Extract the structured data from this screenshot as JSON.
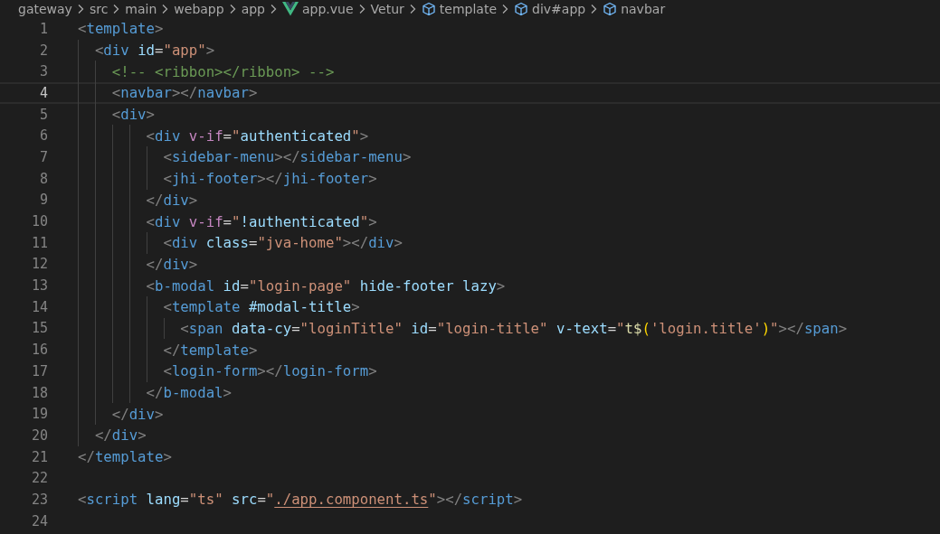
{
  "breadcrumbs": [
    {
      "text": "gateway",
      "kind": "folder"
    },
    {
      "text": "src",
      "kind": "folder"
    },
    {
      "text": "main",
      "kind": "folder"
    },
    {
      "text": "webapp",
      "kind": "folder"
    },
    {
      "text": "app",
      "kind": "folder"
    },
    {
      "text": "app.vue",
      "kind": "vue-file"
    },
    {
      "text": "Vetur",
      "kind": "folder"
    },
    {
      "text": "template",
      "kind": "symbol"
    },
    {
      "text": "div#app",
      "kind": "symbol"
    },
    {
      "text": "navbar",
      "kind": "symbol"
    }
  ],
  "editor": {
    "lines": [
      {
        "number": "1",
        "selected": false,
        "tokens": [
          {
            "kind": "punct",
            "text": "<"
          },
          {
            "kind": "tag",
            "text": "template"
          },
          {
            "kind": "punct",
            "text": ">"
          }
        ]
      },
      {
        "number": "2",
        "selected": false,
        "tokens": [
          {
            "kind": "punct",
            "text": "  <"
          },
          {
            "kind": "tag",
            "text": "div"
          },
          {
            "kind": "attr",
            "text": " id"
          },
          {
            "kind": "eq",
            "text": "="
          },
          {
            "kind": "string",
            "text": "\"app\""
          },
          {
            "kind": "punct",
            "text": ">"
          }
        ]
      },
      {
        "number": "3",
        "selected": false,
        "tokens": [
          {
            "kind": "comment",
            "text": "    <!-- <ribbon></ribbon> -->"
          }
        ]
      },
      {
        "number": "4",
        "selected": true,
        "tokens": [
          {
            "kind": "punct",
            "text": "    <"
          },
          {
            "kind": "tag",
            "text": "navbar"
          },
          {
            "kind": "punct",
            "text": "></"
          },
          {
            "kind": "tag",
            "text": "navbar"
          },
          {
            "kind": "punct",
            "text": ">"
          }
        ]
      },
      {
        "number": "5",
        "selected": false,
        "tokens": [
          {
            "kind": "punct",
            "text": "    <"
          },
          {
            "kind": "tag",
            "text": "div"
          },
          {
            "kind": "punct",
            "text": ">"
          }
        ]
      },
      {
        "number": "6",
        "selected": false,
        "tokens": [
          {
            "kind": "punct",
            "text": "        <"
          },
          {
            "kind": "tag",
            "text": "div"
          },
          {
            "kind": "directive",
            "text": " v-if"
          },
          {
            "kind": "eq",
            "text": "="
          },
          {
            "kind": "string",
            "text": "\""
          },
          {
            "kind": "expr",
            "text": "authenticated"
          },
          {
            "kind": "string",
            "text": "\""
          },
          {
            "kind": "punct",
            "text": ">"
          }
        ]
      },
      {
        "number": "7",
        "selected": false,
        "tokens": [
          {
            "kind": "punct",
            "text": "          <"
          },
          {
            "kind": "tag",
            "text": "sidebar-menu"
          },
          {
            "kind": "punct",
            "text": "></"
          },
          {
            "kind": "tag",
            "text": "sidebar-menu"
          },
          {
            "kind": "punct",
            "text": ">"
          }
        ]
      },
      {
        "number": "8",
        "selected": false,
        "tokens": [
          {
            "kind": "punct",
            "text": "          <"
          },
          {
            "kind": "tag",
            "text": "jhi-footer"
          },
          {
            "kind": "punct",
            "text": "></"
          },
          {
            "kind": "tag",
            "text": "jhi-footer"
          },
          {
            "kind": "punct",
            "text": ">"
          }
        ]
      },
      {
        "number": "9",
        "selected": false,
        "tokens": [
          {
            "kind": "punct",
            "text": "        </"
          },
          {
            "kind": "tag",
            "text": "div"
          },
          {
            "kind": "punct",
            "text": ">"
          }
        ]
      },
      {
        "number": "10",
        "selected": false,
        "tokens": [
          {
            "kind": "punct",
            "text": "        <"
          },
          {
            "kind": "tag",
            "text": "div"
          },
          {
            "kind": "directive",
            "text": " v-if"
          },
          {
            "kind": "eq",
            "text": "="
          },
          {
            "kind": "string",
            "text": "\""
          },
          {
            "kind": "expr",
            "text": "!authenticated"
          },
          {
            "kind": "string",
            "text": "\""
          },
          {
            "kind": "punct",
            "text": ">"
          }
        ]
      },
      {
        "number": "11",
        "selected": false,
        "tokens": [
          {
            "kind": "punct",
            "text": "          <"
          },
          {
            "kind": "tag",
            "text": "div"
          },
          {
            "kind": "attr",
            "text": " class"
          },
          {
            "kind": "eq",
            "text": "="
          },
          {
            "kind": "string",
            "text": "\"jva-home\""
          },
          {
            "kind": "punct",
            "text": "></"
          },
          {
            "kind": "tag",
            "text": "div"
          },
          {
            "kind": "punct",
            "text": ">"
          }
        ]
      },
      {
        "number": "12",
        "selected": false,
        "tokens": [
          {
            "kind": "punct",
            "text": "        </"
          },
          {
            "kind": "tag",
            "text": "div"
          },
          {
            "kind": "punct",
            "text": ">"
          }
        ]
      },
      {
        "number": "13",
        "selected": false,
        "tokens": [
          {
            "kind": "punct",
            "text": "        <"
          },
          {
            "kind": "tag",
            "text": "b-modal"
          },
          {
            "kind": "attr",
            "text": " id"
          },
          {
            "kind": "eq",
            "text": "="
          },
          {
            "kind": "string",
            "text": "\"login-page\""
          },
          {
            "kind": "attr",
            "text": " hide-footer lazy"
          },
          {
            "kind": "punct",
            "text": ">"
          }
        ]
      },
      {
        "number": "14",
        "selected": false,
        "tokens": [
          {
            "kind": "punct",
            "text": "          <"
          },
          {
            "kind": "tag",
            "text": "template"
          },
          {
            "kind": "attr",
            "text": " #modal-title"
          },
          {
            "kind": "punct",
            "text": ">"
          }
        ]
      },
      {
        "number": "15",
        "selected": false,
        "tokens": [
          {
            "kind": "punct",
            "text": "            <"
          },
          {
            "kind": "tag",
            "text": "span"
          },
          {
            "kind": "attr",
            "text": " data-cy"
          },
          {
            "kind": "eq",
            "text": "="
          },
          {
            "kind": "string",
            "text": "\"loginTitle\""
          },
          {
            "kind": "attr",
            "text": " id"
          },
          {
            "kind": "eq",
            "text": "="
          },
          {
            "kind": "string",
            "text": "\"login-title\""
          },
          {
            "kind": "attr",
            "text": " v-text"
          },
          {
            "kind": "eq",
            "text": "="
          },
          {
            "kind": "string",
            "text": "\""
          },
          {
            "kind": "function",
            "text": "t$"
          },
          {
            "kind": "brace",
            "text": "("
          },
          {
            "kind": "string",
            "text": "'login.title'"
          },
          {
            "kind": "brace",
            "text": ")"
          },
          {
            "kind": "string",
            "text": "\""
          },
          {
            "kind": "punct",
            "text": "></"
          },
          {
            "kind": "tag",
            "text": "span"
          },
          {
            "kind": "punct",
            "text": ">"
          }
        ]
      },
      {
        "number": "16",
        "selected": false,
        "tokens": [
          {
            "kind": "punct",
            "text": "          </"
          },
          {
            "kind": "tag",
            "text": "template"
          },
          {
            "kind": "punct",
            "text": ">"
          }
        ]
      },
      {
        "number": "17",
        "selected": false,
        "tokens": [
          {
            "kind": "punct",
            "text": "          <"
          },
          {
            "kind": "tag",
            "text": "login-form"
          },
          {
            "kind": "punct",
            "text": "></"
          },
          {
            "kind": "tag",
            "text": "login-form"
          },
          {
            "kind": "punct",
            "text": ">"
          }
        ]
      },
      {
        "number": "18",
        "selected": false,
        "tokens": [
          {
            "kind": "punct",
            "text": "        </"
          },
          {
            "kind": "tag",
            "text": "b-modal"
          },
          {
            "kind": "punct",
            "text": ">"
          }
        ]
      },
      {
        "number": "19",
        "selected": false,
        "tokens": [
          {
            "kind": "punct",
            "text": "    </"
          },
          {
            "kind": "tag",
            "text": "div"
          },
          {
            "kind": "punct",
            "text": ">"
          }
        ]
      },
      {
        "number": "20",
        "selected": false,
        "tokens": [
          {
            "kind": "punct",
            "text": "  </"
          },
          {
            "kind": "tag",
            "text": "div"
          },
          {
            "kind": "punct",
            "text": ">"
          }
        ]
      },
      {
        "number": "21",
        "selected": false,
        "tokens": [
          {
            "kind": "punct",
            "text": "</"
          },
          {
            "kind": "tag",
            "text": "template"
          },
          {
            "kind": "punct",
            "text": ">"
          }
        ]
      },
      {
        "number": "22",
        "selected": false
      },
      {
        "number": "23",
        "selected": false,
        "tokens": [
          {
            "kind": "punct",
            "text": "<"
          },
          {
            "kind": "tag",
            "text": "script"
          },
          {
            "kind": "attr",
            "text": " lang"
          },
          {
            "kind": "eq",
            "text": "="
          },
          {
            "kind": "string",
            "text": "\"ts\""
          },
          {
            "kind": "attr",
            "text": " src"
          },
          {
            "kind": "eq",
            "text": "="
          },
          {
            "kind": "string",
            "text": "\""
          },
          {
            "kind": "link",
            "text": "./app.component.ts"
          },
          {
            "kind": "string",
            "text": "\""
          },
          {
            "kind": "punct",
            "text": "></"
          },
          {
            "kind": "tag",
            "text": "script"
          },
          {
            "kind": "punct",
            "text": ">"
          }
        ]
      },
      {
        "number": "24",
        "selected": false
      }
    ]
  }
}
